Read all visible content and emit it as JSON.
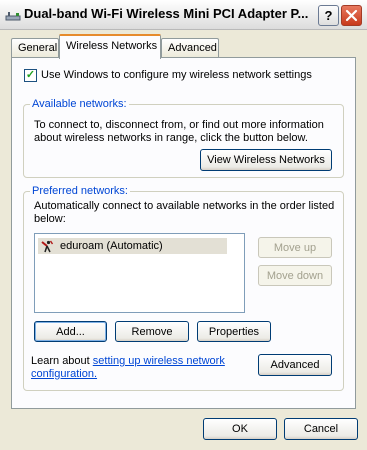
{
  "window": {
    "title": "Dual-band Wi-Fi Wireless Mini PCI Adapter P...",
    "help_label": "?",
    "icons": {
      "app": "network-adapter-icon",
      "close": "close-icon"
    }
  },
  "tabs": [
    {
      "label": "General",
      "active": false
    },
    {
      "label": "Wireless Networks",
      "active": true
    },
    {
      "label": "Advanced",
      "active": false
    }
  ],
  "use_windows": {
    "checked": true,
    "label": "Use Windows to configure my wireless network settings"
  },
  "available": {
    "title": "Available networks:",
    "description_line1": "To connect to, disconnect from, or find out more information",
    "description_line2": "about wireless networks in range, click the button below.",
    "button_label": "View Wireless Networks"
  },
  "preferred": {
    "title": "Preferred networks:",
    "description_line1": "Automatically connect to available networks in the order listed",
    "description_line2": "below:",
    "networks": [
      {
        "name": "eduroam (Automatic)",
        "icon": "wireless-network-icon"
      }
    ],
    "move_up_label": "Move up",
    "move_down_label": "Move down",
    "add_label": "Add...",
    "remove_label": "Remove",
    "properties_label": "Properties"
  },
  "learn": {
    "prefix": "Learn about ",
    "link_line1": "setting up wireless network",
    "link_line2": "configuration.",
    "advanced_label": "Advanced"
  },
  "footer": {
    "ok_label": "OK",
    "cancel_label": "Cancel"
  },
  "colors": {
    "background": "#ece9d8",
    "panel": "#fcfcfe",
    "group_title": "#0046d5",
    "active_tab_accent": "#e68b2c",
    "close_button": "#c8391c"
  }
}
